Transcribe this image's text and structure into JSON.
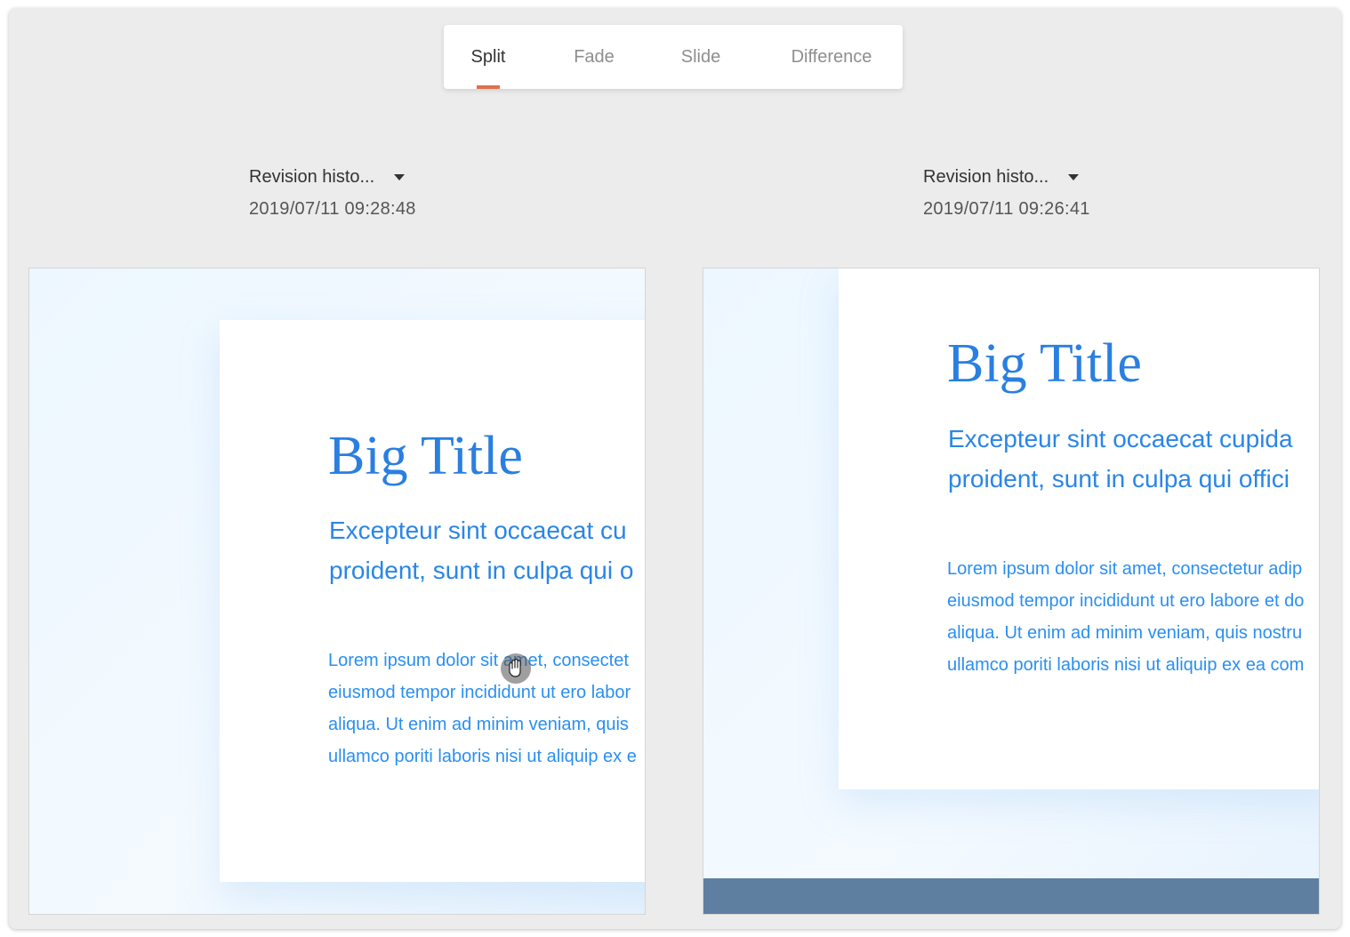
{
  "mode_tabs": [
    {
      "label": "Split",
      "active": true
    },
    {
      "label": "Fade",
      "active": false
    },
    {
      "label": "Slide",
      "active": false
    },
    {
      "label": "Difference",
      "active": false
    }
  ],
  "accent_color": "#e0714a",
  "left": {
    "revision_label": "Revision histo...",
    "timestamp": "2019/07/11 09:28:48",
    "slide": {
      "title": "Big Title",
      "subtitle_lines": [
        "Excepteur sint occaecat cu",
        "proident, sunt in culpa qui o"
      ],
      "body_lines": [
        "Lorem ipsum dolor sit amet, consectet",
        "eiusmod tempor incididunt ut ero labor",
        "aliqua. Ut enim ad minim veniam, quis",
        "ullamco poriti laboris nisi ut aliquip ex e"
      ]
    }
  },
  "right": {
    "revision_label": "Revision histo...",
    "timestamp": "2019/07/11 09:26:41",
    "slide": {
      "title": "Big Title",
      "subtitle_lines": [
        "Excepteur sint occaecat cupida",
        "proident, sunt in culpa qui offici"
      ],
      "body_lines": [
        "Lorem ipsum dolor sit amet, consectetur adip",
        "eiusmod tempor incididunt ut ero labore et do",
        "aliqua. Ut enim ad minim veniam, quis nostru",
        "ullamco poriti laboris nisi ut aliquip ex ea com"
      ]
    }
  },
  "icons": {
    "caret": "caret-down-icon",
    "cursor": "hand-cursor-icon"
  }
}
